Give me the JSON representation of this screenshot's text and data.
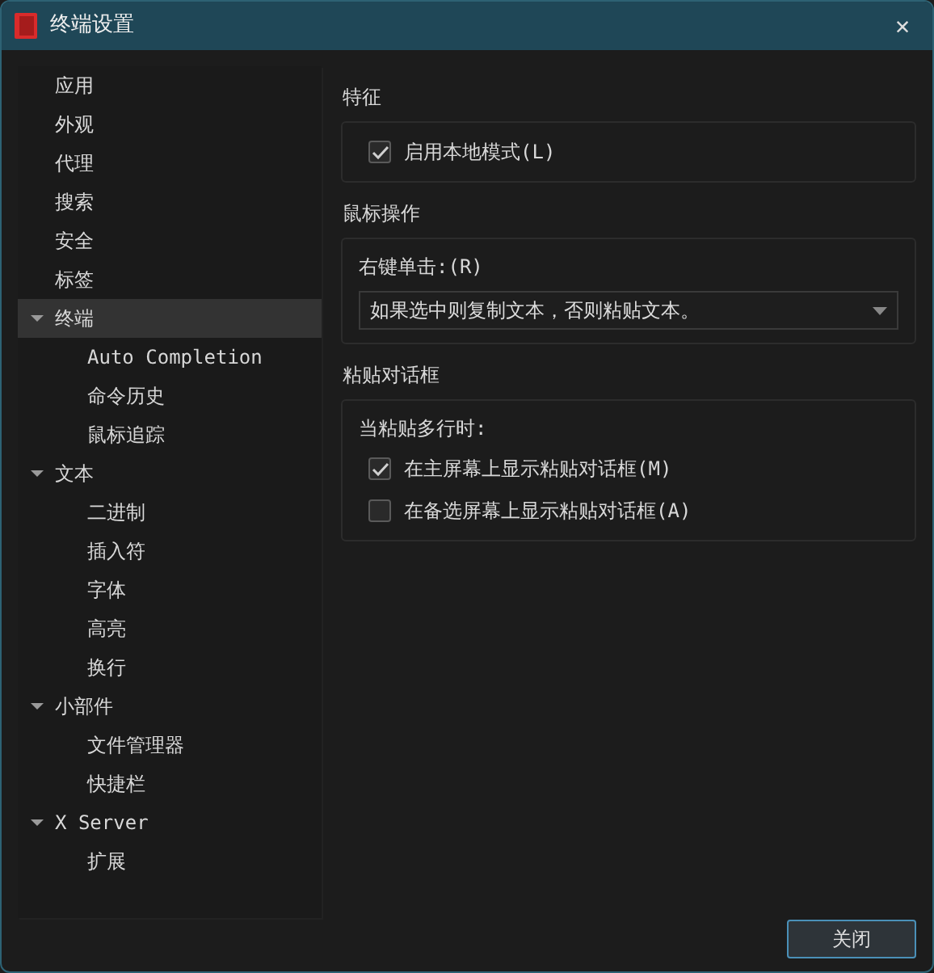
{
  "window": {
    "title": "终端设置",
    "close": "✕"
  },
  "sidebar": {
    "items": [
      {
        "label": "应用",
        "selected": false
      },
      {
        "label": "外观",
        "selected": false
      },
      {
        "label": "代理",
        "selected": false
      },
      {
        "label": "搜索",
        "selected": false
      },
      {
        "label": "安全",
        "selected": false
      },
      {
        "label": "标签",
        "selected": false
      },
      {
        "label": "终端",
        "selected": true,
        "expanded": true,
        "children": [
          {
            "label": "Auto Completion",
            "selected": false
          },
          {
            "label": "命令历史",
            "selected": false
          },
          {
            "label": "鼠标追踪",
            "selected": false
          }
        ]
      },
      {
        "label": "文本",
        "selected": false,
        "expanded": true,
        "children": [
          {
            "label": "二进制",
            "selected": false
          },
          {
            "label": "插入符",
            "selected": false
          },
          {
            "label": "字体",
            "selected": false
          },
          {
            "label": "高亮",
            "selected": false
          },
          {
            "label": "换行",
            "selected": false
          }
        ]
      },
      {
        "label": "小部件",
        "selected": false,
        "expanded": true,
        "children": [
          {
            "label": "文件管理器",
            "selected": false
          },
          {
            "label": "快捷栏",
            "selected": false
          }
        ]
      },
      {
        "label": "X Server",
        "selected": false,
        "expanded": true,
        "children": [
          {
            "label": "扩展",
            "selected": false
          }
        ]
      }
    ]
  },
  "sections": [
    {
      "title": "特征",
      "rows": [
        {
          "kind": "checkbox",
          "label": "启用本地模式(L)",
          "checked": true
        }
      ]
    },
    {
      "title": "鼠标操作",
      "rows": [
        {
          "kind": "label",
          "label": "右键单击:(R)"
        },
        {
          "kind": "select",
          "value": "如果选中则复制文本，否则粘贴文本。"
        }
      ]
    },
    {
      "title": "粘贴对话框",
      "rows": [
        {
          "kind": "label",
          "label": "当粘贴多行时:"
        },
        {
          "kind": "checkbox",
          "label": "在主屏幕上显示粘贴对话框(M)",
          "checked": true
        },
        {
          "kind": "checkbox",
          "label": "在备选屏幕上显示粘贴对话框(A)",
          "checked": false
        }
      ]
    }
  ],
  "footer": {
    "button": "关闭"
  }
}
